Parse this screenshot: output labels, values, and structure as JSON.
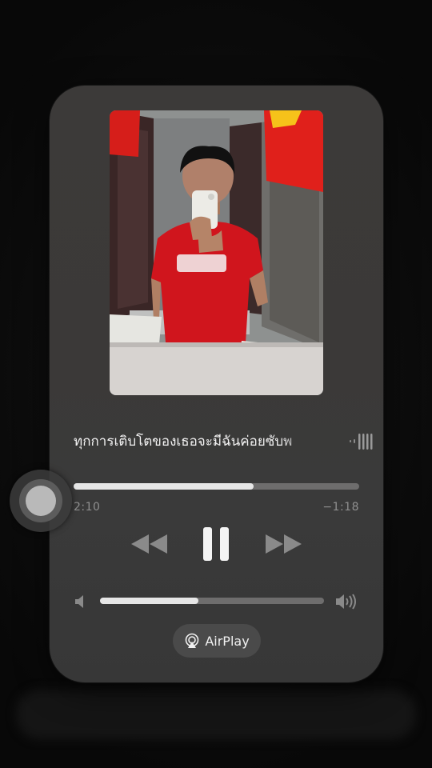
{
  "now_playing": {
    "title": "ทุกการเติบโตของเธอจะมีฉันค่อยซับพ",
    "elapsed": "2:10",
    "remaining": "−1:18",
    "progress_fraction": 0.63,
    "volume_fraction": 0.44,
    "airplay_label": "AirPlay"
  },
  "icons": {
    "rewind": "rewind-icon",
    "pause": "pause-icon",
    "forward": "fast-forward-icon",
    "volume_low": "speaker-low-icon",
    "volume_high": "speaker-high-icon",
    "airplay": "airplay-icon",
    "waveform": "waveform-icon"
  },
  "colors": {
    "card": "#3b3938",
    "track": "#6e6d6d",
    "fill": "#e6e6e6",
    "text_secondary": "#8f8f8f"
  }
}
